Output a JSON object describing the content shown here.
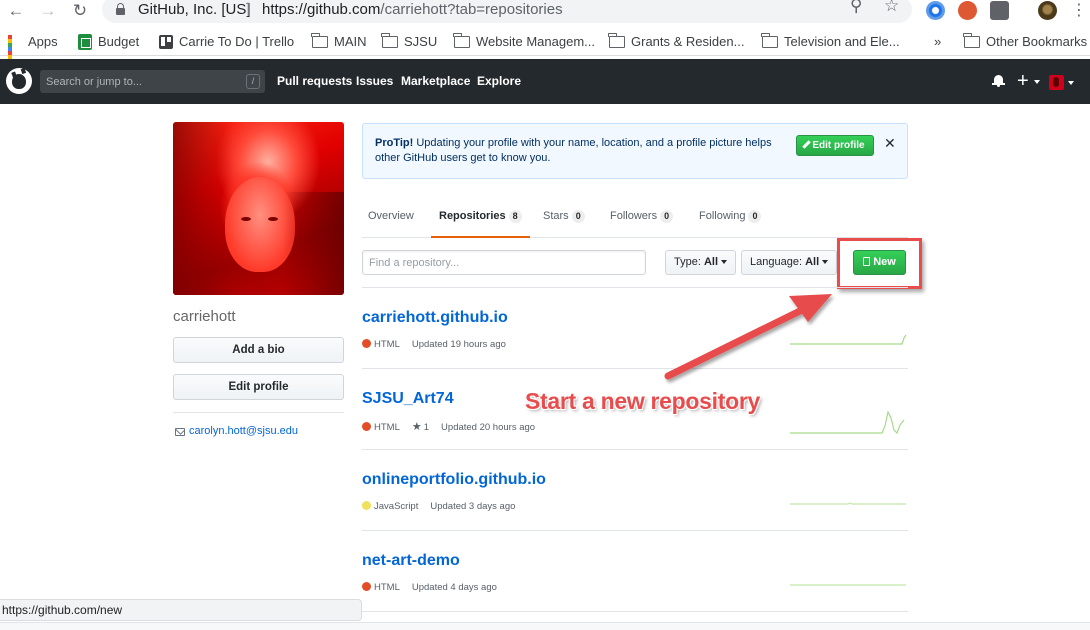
{
  "browser": {
    "site_identity": "GitHub, Inc. [US]",
    "url_host": "https://github.com",
    "url_path": "/carriehott?tab=repositories",
    "icons": [
      "back-arrow-icon",
      "forward-arrow-icon",
      "reload-icon",
      "lock-icon",
      "zoom-icon",
      "star-bookmark-icon"
    ],
    "bookmarks": [
      {
        "label": "Apps",
        "icon": "apps-grid-icon"
      },
      {
        "label": "Budget",
        "icon": "sheets-icon"
      },
      {
        "label": "Carrie To Do | Trello",
        "icon": "trello-icon"
      },
      {
        "label": "MAIN",
        "icon": "folder-icon"
      },
      {
        "label": "SJSU",
        "icon": "folder-icon"
      },
      {
        "label": "Website Managem...",
        "icon": "folder-icon"
      },
      {
        "label": "Grants & Residen...",
        "icon": "folder-icon"
      },
      {
        "label": "Television and Ele...",
        "icon": "folder-icon"
      }
    ],
    "overflow_label": "»",
    "other_bookmarks": "Other Bookmarks",
    "status_url": "https://github.com/new"
  },
  "header": {
    "search_placeholder": "Search or jump to...",
    "search_key": "/",
    "nav": [
      "Pull requests",
      "Issues",
      "Marketplace",
      "Explore"
    ],
    "plus_label": "+",
    "bg_color": "#24292e"
  },
  "profile": {
    "username": "carriehott",
    "add_bio_label": "Add a bio",
    "edit_profile_label": "Edit profile",
    "email": "carolyn.hott@sjsu.edu"
  },
  "protip": {
    "lead": "ProTip!",
    "text": " Updating your profile with your name, location, and a profile picture helps other GitHub users get to know you.",
    "button_label": "Edit profile",
    "close_label": "✕"
  },
  "tabs": [
    {
      "label": "Overview",
      "count": null
    },
    {
      "label": "Repositories",
      "count": "8"
    },
    {
      "label": "Stars",
      "count": "0"
    },
    {
      "label": "Followers",
      "count": "0"
    },
    {
      "label": "Following",
      "count": "0"
    }
  ],
  "filters": {
    "search_placeholder": "Find a repository...",
    "type_label": "Type:",
    "type_value": "All",
    "language_label": "Language:",
    "language_value": "All",
    "new_label": "New"
  },
  "repos": [
    {
      "name": "carriehott.github.io",
      "language": "HTML",
      "lang_color": "#e34c26",
      "stars": null,
      "updated": "Updated 19 hours ago"
    },
    {
      "name": "SJSU_Art74",
      "language": "HTML",
      "lang_color": "#e34c26",
      "stars": "1",
      "updated": "Updated 20 hours ago"
    },
    {
      "name": "onlineportfolio.github.io",
      "language": "JavaScript",
      "lang_color": "#f1e05a",
      "stars": null,
      "updated": "Updated 3 days ago"
    },
    {
      "name": "net-art-demo",
      "language": "HTML",
      "lang_color": "#e34c26",
      "stars": null,
      "updated": "Updated 4 days ago"
    }
  ],
  "annotation": {
    "text": "Start a new repository",
    "color": "#e84c4c"
  },
  "colors": {
    "link": "#0366d6",
    "green": "#28a745",
    "tab_accent": "#e36209",
    "spark": "#c2e8a8"
  }
}
